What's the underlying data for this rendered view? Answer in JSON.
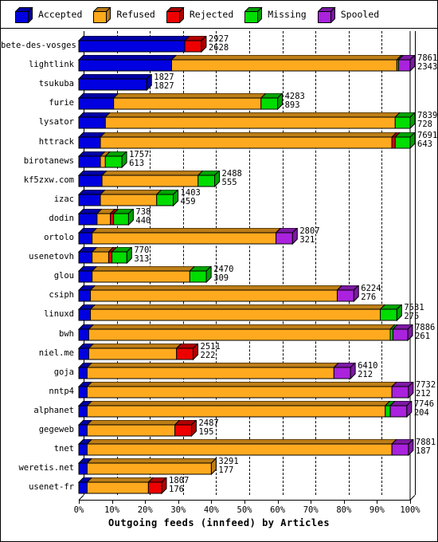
{
  "legend": {
    "items": [
      {
        "label": "Accepted",
        "color": "#0000e0",
        "icon": "cube-icon"
      },
      {
        "label": "Refused",
        "color": "#ffaa1e",
        "icon": "cube-icon"
      },
      {
        "label": "Rejected",
        "color": "#ee0000",
        "icon": "cube-icon"
      },
      {
        "label": "Missing",
        "color": "#00dd00",
        "icon": "cube-icon"
      },
      {
        "label": "Spooled",
        "color": "#aa22dd",
        "icon": "cube-icon"
      }
    ]
  },
  "axis": {
    "x_title": "Outgoing feeds (innfeed) by Articles",
    "x_ticks": [
      "0%",
      "10%",
      "20%",
      "30%",
      "40%",
      "50%",
      "60%",
      "70%",
      "80%",
      "90%",
      "100%"
    ]
  },
  "chart_data": {
    "type": "bar",
    "orientation": "horizontal",
    "stacked": true,
    "title": "Outgoing feeds (innfeed) by Articles",
    "xlabel": "Outgoing feeds (innfeed) by Articles",
    "ylabel": "",
    "xlim": [
      0,
      100
    ],
    "x_unit": "percent",
    "grid": true,
    "legend_position": "top",
    "series": [
      {
        "name": "Accepted",
        "color": "#0000e0"
      },
      {
        "name": "Refused",
        "color": "#ffaa1e"
      },
      {
        "name": "Rejected",
        "color": "#ee0000"
      },
      {
        "name": "Missing",
        "color": "#00dd00"
      },
      {
        "name": "Spooled",
        "color": "#aa22dd"
      }
    ],
    "categories": [
      "bete-des-vosges",
      "lightlink",
      "tsukuba",
      "furie",
      "lysator",
      "httrack",
      "birotanews",
      "kf5zxw.com",
      "izac",
      "dodin",
      "ortolo",
      "usenetovh",
      "glou",
      "csiph",
      "linuxd",
      "bwh",
      "niel.me",
      "goja",
      "nntp4",
      "alphanet",
      "gegeweb",
      "tnet",
      "weretis.net",
      "usenet-fr"
    ],
    "rows": [
      {
        "name": "bete-des-vosges",
        "total": 2927,
        "offered": 2628,
        "pct": [
          32.0,
          0.0,
          5.0,
          0.0,
          0.0
        ]
      },
      {
        "name": "lightlink",
        "total": 7861,
        "offered": 2343,
        "pct": [
          28.0,
          68.0,
          0.0,
          0.5,
          3.5
        ]
      },
      {
        "name": "tsukuba",
        "total": 1827,
        "offered": 1827,
        "pct": [
          20.5,
          0.0,
          0.0,
          0.0,
          0.0
        ]
      },
      {
        "name": "furie",
        "total": 4283,
        "offered": 893,
        "pct": [
          10.5,
          44.5,
          0.0,
          5.0,
          0.0
        ]
      },
      {
        "name": "lysator",
        "total": 7839,
        "offered": 728,
        "pct": [
          8.0,
          87.5,
          0.0,
          4.5,
          0.0
        ]
      },
      {
        "name": "httrack",
        "total": 7691,
        "offered": 643,
        "pct": [
          6.5,
          88.0,
          1.0,
          4.5,
          0.0
        ]
      },
      {
        "name": "birotanews",
        "total": 1757,
        "offered": 613,
        "pct": [
          6.5,
          1.5,
          0.0,
          5.0,
          0.0
        ]
      },
      {
        "name": "kf5zxw.com",
        "total": 2488,
        "offered": 555,
        "pct": [
          7.0,
          29.0,
          0.0,
          5.0,
          0.0
        ]
      },
      {
        "name": "izac",
        "total": 1403,
        "offered": 459,
        "pct": [
          6.5,
          17.0,
          0.0,
          5.0,
          0.0
        ]
      },
      {
        "name": "dodin",
        "total": 738,
        "offered": 440,
        "pct": [
          5.5,
          4.0,
          1.0,
          4.5,
          0.0
        ]
      },
      {
        "name": "ortolo",
        "total": 2807,
        "offered": 321,
        "pct": [
          4.0,
          55.5,
          0.0,
          0.0,
          5.0
        ]
      },
      {
        "name": "usenetovh",
        "total": 770,
        "offered": 313,
        "pct": [
          4.0,
          5.0,
          1.0,
          4.5,
          0.0
        ]
      },
      {
        "name": "glou",
        "total": 2470,
        "offered": 309,
        "pct": [
          4.0,
          29.5,
          0.0,
          5.0,
          0.0
        ]
      },
      {
        "name": "csiph",
        "total": 6224,
        "offered": 276,
        "pct": [
          3.5,
          74.5,
          0.0,
          0.0,
          5.0
        ]
      },
      {
        "name": "linuxd",
        "total": 7531,
        "offered": 275,
        "pct": [
          3.5,
          87.5,
          0.0,
          5.0,
          0.0
        ]
      },
      {
        "name": "bwh",
        "total": 7886,
        "offered": 261,
        "pct": [
          3.0,
          91.0,
          0.0,
          0.8,
          4.5
        ]
      },
      {
        "name": "niel.me",
        "total": 2511,
        "offered": 222,
        "pct": [
          3.0,
          26.5,
          5.0,
          0.0,
          0.0
        ]
      },
      {
        "name": "goja",
        "total": 6410,
        "offered": 212,
        "pct": [
          2.5,
          74.5,
          0.0,
          0.0,
          5.0
        ]
      },
      {
        "name": "nntp4",
        "total": 7732,
        "offered": 212,
        "pct": [
          2.5,
          92.0,
          0.0,
          0.0,
          5.0
        ]
      },
      {
        "name": "alphanet",
        "total": 7746,
        "offered": 204,
        "pct": [
          2.5,
          90.0,
          0.0,
          1.5,
          5.0
        ]
      },
      {
        "name": "gegeweb",
        "total": 2487,
        "offered": 195,
        "pct": [
          2.5,
          26.5,
          5.0,
          0.0,
          0.0
        ]
      },
      {
        "name": "tnet",
        "total": 7881,
        "offered": 187,
        "pct": [
          2.5,
          92.0,
          0.0,
          0.0,
          5.0
        ]
      },
      {
        "name": "weretis.net",
        "total": 3291,
        "offered": 177,
        "pct": [
          2.5,
          37.5,
          0.0,
          0.0,
          0.0
        ]
      },
      {
        "name": "usenet-fr",
        "total": 1807,
        "offered": 176,
        "pct": [
          2.5,
          18.5,
          4.0,
          0.0,
          0.0
        ]
      }
    ]
  }
}
